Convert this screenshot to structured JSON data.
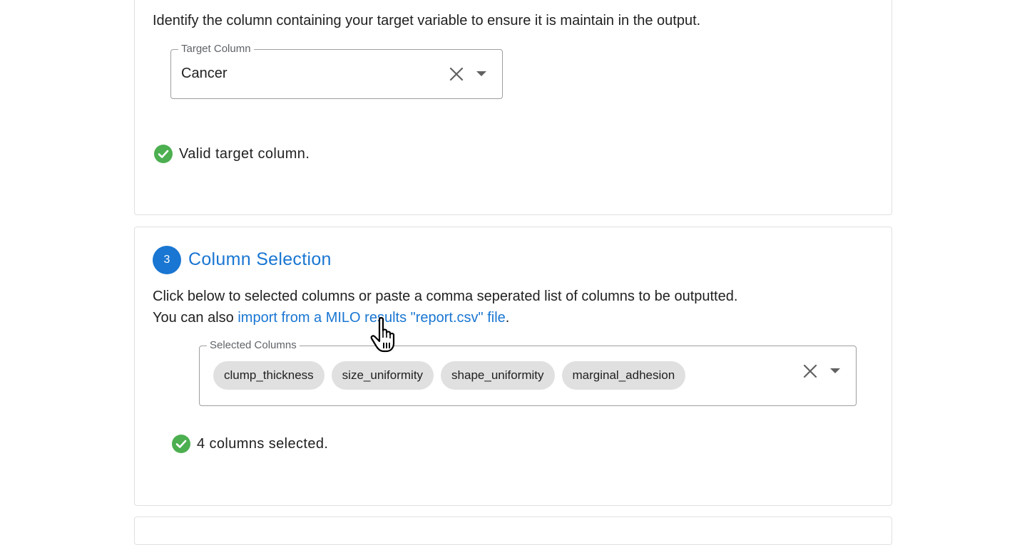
{
  "target_section": {
    "description": "Identify the column containing your target variable to ensure it is maintain in the output.",
    "field_label": "Target Column",
    "field_value": "Cancer",
    "status": "Valid target column."
  },
  "column_section": {
    "step_number": "3",
    "title": "Column Selection",
    "description_line1": "Click below to selected columns or paste a comma seperated list of columns to be outputted.",
    "description_line2_prefix": "You can also ",
    "import_link": "import from a MILO results \"report.csv\" file",
    "description_line2_suffix": ".",
    "field_label": "Selected Columns",
    "chips": [
      "clump_thickness",
      "size_uniformity",
      "shape_uniformity",
      "marginal_adhesion"
    ],
    "status": "4 columns selected."
  },
  "colors": {
    "accent": "#1976d2",
    "success": "#4caf50",
    "chip_bg": "#e0e0e0"
  },
  "icons": [
    "close-icon",
    "arrow-drop-down-icon",
    "check-circle-icon",
    "hand-pointer-icon"
  ]
}
